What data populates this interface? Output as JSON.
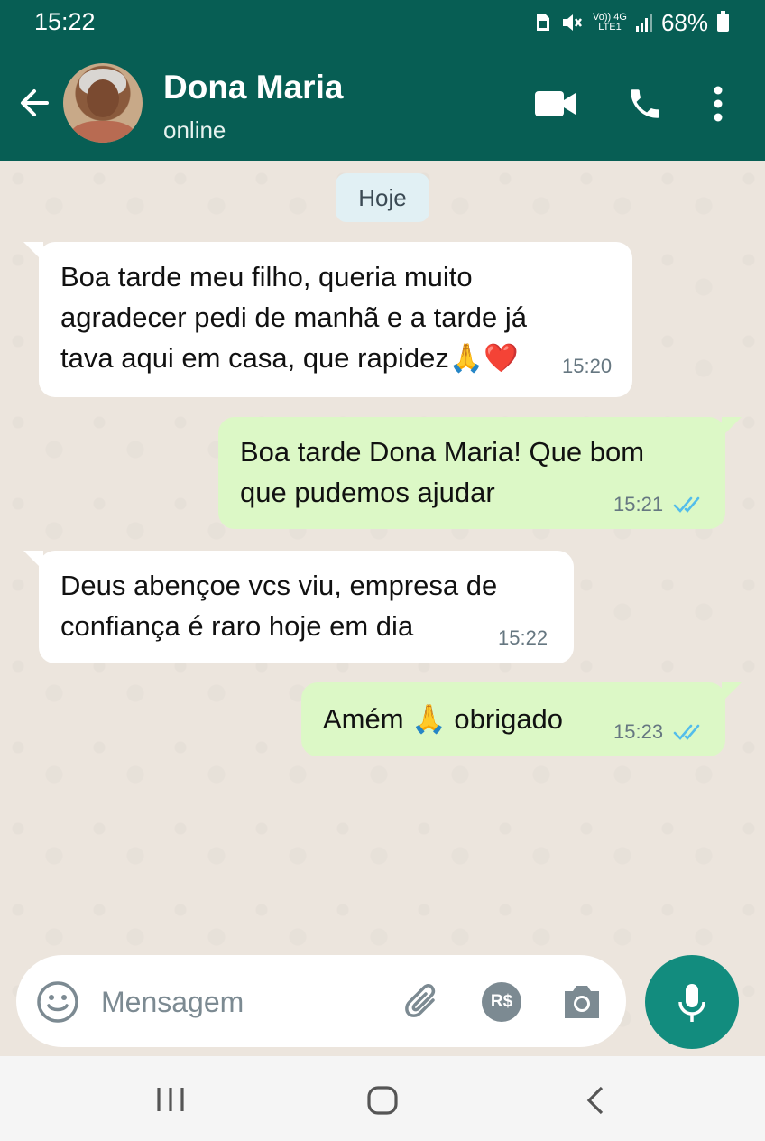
{
  "status_bar": {
    "time": "15:22",
    "network_top": "Vo)) 4G",
    "network_bottom": "LTE1",
    "battery": "68%"
  },
  "header": {
    "contact_name": "Dona Maria",
    "status": "online",
    "icons": [
      "back-arrow-icon",
      "video-call-icon",
      "phone-icon",
      "more-vertical-icon"
    ]
  },
  "chat": {
    "date_chip": "Hoje",
    "messages": [
      {
        "direction": "incoming",
        "lines": [
          "Boa tarde meu filho, queria muito",
          "agradecer pedi de manhã e a tarde já",
          "tava aqui em casa, que rapidez🙏❤️"
        ],
        "time": "15:20"
      },
      {
        "direction": "outgoing",
        "lines": [
          "Boa tarde Dona Maria! Que bom",
          "que pudemos ajudar"
        ],
        "time": "15:21",
        "status": "read"
      },
      {
        "direction": "incoming",
        "lines": [
          "Deus abençoe vcs viu, empresa de",
          "confiança é raro hoje em dia"
        ],
        "time": "15:22"
      },
      {
        "direction": "outgoing",
        "lines": [
          "Amém 🙏 obrigado"
        ],
        "time": "15:23",
        "status": "read"
      }
    ]
  },
  "composer": {
    "placeholder": "Mensagem",
    "icons": [
      "emoji-icon",
      "attach-icon",
      "payment-rs-icon",
      "camera-icon",
      "mic-icon"
    ],
    "payment_label": "R$"
  },
  "colors": {
    "header": "#075e54",
    "incoming_bubble": "#ffffff",
    "outgoing_bubble": "#dcf8c6",
    "read_ticks": "#53bdeb",
    "mic_button": "#128c7e"
  }
}
